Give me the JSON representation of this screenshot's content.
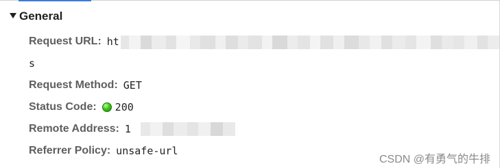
{
  "section": {
    "title": "General",
    "collapse_icon": "triangle-down-icon"
  },
  "headers": {
    "request_url": {
      "label": "Request URL:",
      "value_visible_prefix": "ht",
      "value_continuation": "s"
    },
    "request_method": {
      "label": "Request Method:",
      "value": "GET"
    },
    "status_code": {
      "label": "Status Code:",
      "status_icon": "green-dot-icon",
      "status_color": "#3cbf14",
      "value": "200"
    },
    "remote_address": {
      "label": "Remote Address:",
      "value_visible_prefix": "1"
    },
    "referrer_policy": {
      "label": "Referrer Policy:",
      "value": "unsafe-url"
    }
  },
  "watermark": {
    "text": "CSDN @有勇气的牛排"
  },
  "colors": {
    "label": "#5e5e5e",
    "value": "#222222",
    "accent": "#3c7be0"
  }
}
